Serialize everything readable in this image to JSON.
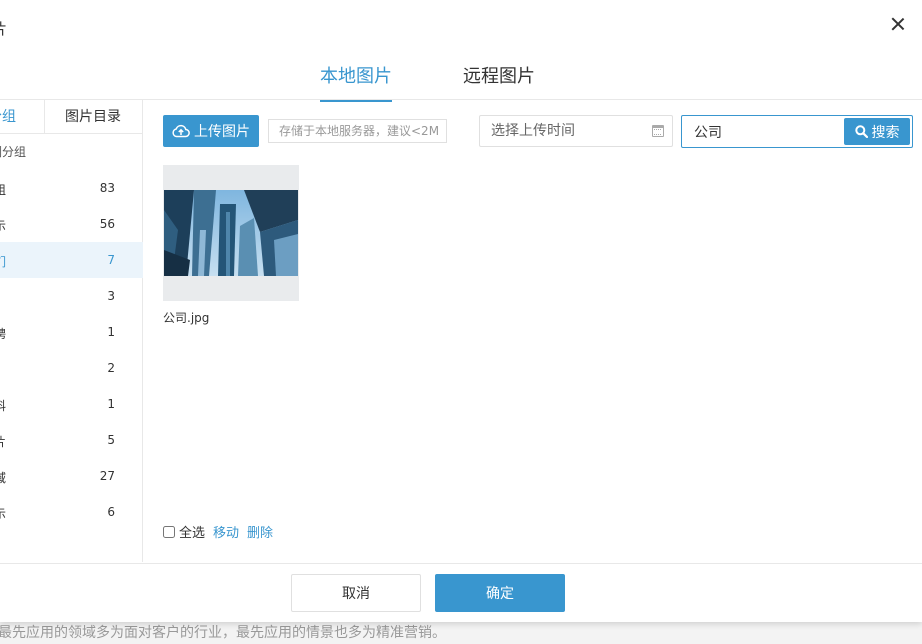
{
  "background_text": "最先应用的领域多为面对客户的行业，最先应用的情景也多为精准营销。",
  "dialog": {
    "title": "片",
    "close_icon": "close-icon"
  },
  "tabs": {
    "local": "本地图片",
    "remote": "远程图片"
  },
  "sidebar": {
    "tab_groups": "分组",
    "tab_directory": "图片目录",
    "group_header": "刷分组",
    "groups": [
      {
        "name": "组",
        "count": "83"
      },
      {
        "name": "示",
        "count": "56"
      },
      {
        "name": "们",
        "count": "7"
      },
      {
        "name": "",
        "count": "3"
      },
      {
        "name": "聘",
        "count": "1"
      },
      {
        "name": "",
        "count": "2"
      },
      {
        "name": "科",
        "count": "1"
      },
      {
        "name": "片",
        "count": "5"
      },
      {
        "name": "域",
        "count": "27"
      },
      {
        "name": "示",
        "count": "6"
      }
    ],
    "active_index": 2
  },
  "toolbar": {
    "upload_label": "上传图片",
    "upload_hint": "存储于本地服务器，建议<2M",
    "date_placeholder": "选择上传时间",
    "search_value": "公司",
    "search_label": "搜索"
  },
  "images": [
    {
      "name": "公司.jpg"
    }
  ],
  "bottom": {
    "select_all": "全选",
    "move": "移动",
    "delete": "删除"
  },
  "footer": {
    "cancel": "取消",
    "ok": "确定"
  },
  "colors": {
    "accent": "#3996cf"
  }
}
